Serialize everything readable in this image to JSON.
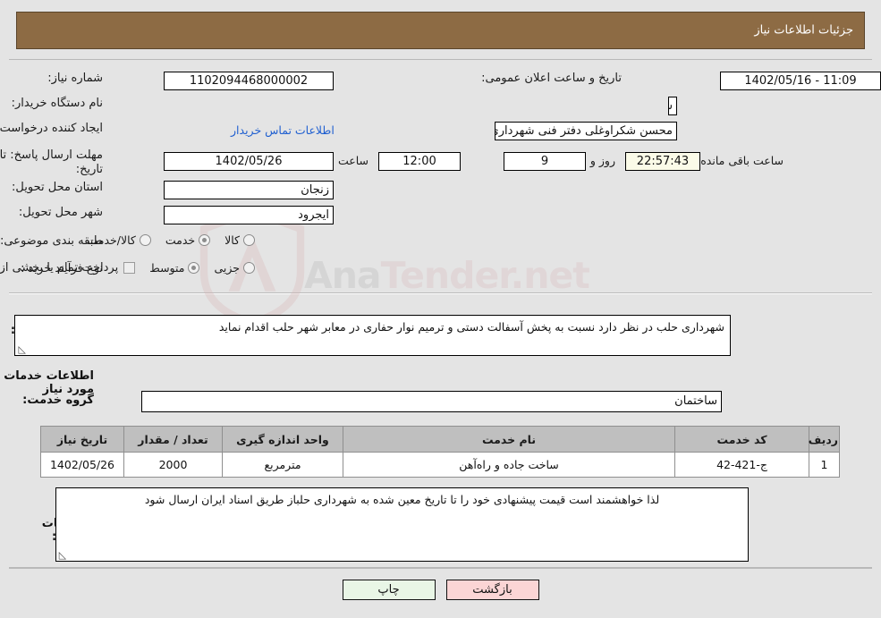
{
  "header": {
    "title": "جزئیات اطلاعات نیاز"
  },
  "watermark": {
    "text_left": "Ana",
    "text_right": "Tender.net"
  },
  "form": {
    "need_number": {
      "label": "شماره نیاز:",
      "value": "1102094468000002"
    },
    "public_announce": {
      "label": "تاریخ و ساعت اعلان عمومی:",
      "value": "11:09 - 1402/05/16"
    },
    "buyer_org": {
      "label": "نام دستگاه خریدار:",
      "value": "شهرداری حلب استان زنجان"
    },
    "request_creator": {
      "label": "ایجاد کننده درخواست:",
      "value": "محسن شکراوغلی دفتر فنی شهرداری حلب استان زنجان"
    },
    "contact_link": {
      "label": "اطلاعات تماس خریدار"
    },
    "deadline": {
      "label_line1": "مهلت ارسال پاسخ: تا",
      "label_line2": "تاریخ:",
      "date": "1402/05/26",
      "hour_label": "ساعت",
      "hour": "12:00",
      "days": "9",
      "days_label": "روز و",
      "countdown": "22:57:43",
      "countdown_label": "ساعت باقی مانده"
    },
    "delivery_province": {
      "label": "استان محل تحویل:",
      "value": "زنجان"
    },
    "delivery_city": {
      "label": "شهر محل تحویل:",
      "value": "ایجرود"
    },
    "subject_class": {
      "label": "طبقه بندی موضوعی:",
      "options": [
        {
          "label": "کالا",
          "selected": false
        },
        {
          "label": "خدمت",
          "selected": true
        },
        {
          "label": "کالا/خدمت",
          "selected": false
        }
      ]
    },
    "purchase_type": {
      "label": "نوع فرآیند خرید :",
      "options": [
        {
          "label": "جزیی",
          "selected": false
        },
        {
          "label": "متوسط",
          "selected": true
        }
      ],
      "checkbox_note": "پرداخت تمام یا بخشی از مبلغ خرید،از محل \"اسناد خزانه اسلامی\" خواهد بود.",
      "checkbox_checked": false
    }
  },
  "description": {
    "label": "شرح کلی نیاز:",
    "value": "شهرداری حلب در نظر دارد نسبت به پخش آسفالت دستی و ترمیم نوار حفاری در معابر شهر حلب اقدام نماید"
  },
  "services_section": {
    "heading": "اطلاعات خدمات مورد نیاز",
    "group": {
      "label": "گروه خدمت:",
      "value": "ساختمان"
    },
    "table": {
      "columns": [
        "ردیف",
        "کد خدمت",
        "نام خدمت",
        "واحد اندازه گیری",
        "تعداد / مقدار",
        "تاریخ نیاز"
      ],
      "rows": [
        [
          "1",
          "ج-421-42",
          "ساخت جاده و راه‌آهن",
          "مترمربع",
          "2000",
          "1402/05/26"
        ]
      ]
    }
  },
  "buyer_notes": {
    "label": "توضیحات خریدار:",
    "value": "لذا خواهشمند است قیمت پیشنهادی خود را تا تاریخ معین شده به شهرداری حلباز طریق اسناد ایران  ارسال شود"
  },
  "buttons": {
    "print": "چاپ",
    "back": "بازگشت"
  }
}
